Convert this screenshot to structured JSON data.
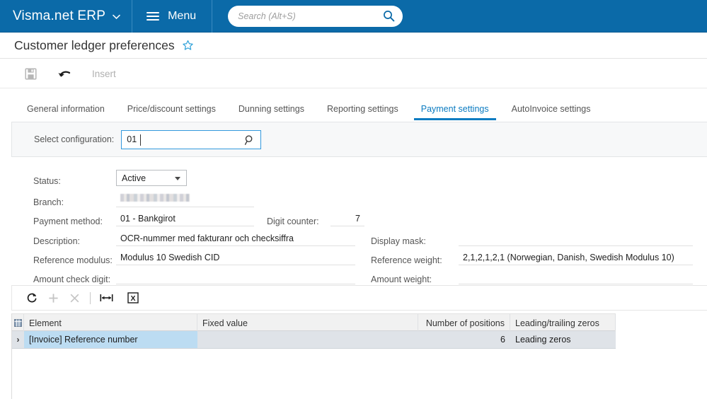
{
  "topbar": {
    "brand": "Visma.net ERP",
    "brand_caret_icon": "chevron-down-icon",
    "menu_label": "Menu",
    "menu_icon": "hamburger-icon",
    "search_placeholder": "Search (Alt+S)",
    "search_value": "",
    "search_icon": "search-icon",
    "background_color": "#0b6aa8"
  },
  "page": {
    "title": "Customer ledger preferences",
    "favorite_icon": "star-icon"
  },
  "action_bar": {
    "save_icon": "save-disk-icon",
    "undo_icon": "undo-arrow-icon",
    "insert_label": "Insert"
  },
  "tabs": [
    {
      "label": "General information",
      "active": false
    },
    {
      "label": "Price/discount settings",
      "active": false
    },
    {
      "label": "Dunning settings",
      "active": false
    },
    {
      "label": "Reporting settings",
      "active": false
    },
    {
      "label": "Payment settings",
      "active": true
    },
    {
      "label": "AutoInvoice settings",
      "active": false
    }
  ],
  "tab_accent_color": "#0b7bc1",
  "config": {
    "label": "Select configuration:",
    "value": "01",
    "placeholder": "",
    "lookup_icon": "magnifier-lookup-icon"
  },
  "form": {
    "status": {
      "label": "Status:",
      "value": "Active",
      "caret_icon": "dropdown-caret-icon"
    },
    "branch": {
      "label": "Branch:",
      "value": "",
      "redacted": true
    },
    "payment_method": {
      "label": "Payment method:",
      "value": "01 - Bankgirot"
    },
    "digit_counter": {
      "label": "Digit counter:",
      "value": "7"
    },
    "description": {
      "label": "Description:",
      "value": "OCR-nummer med fakturanr och checksiffra"
    },
    "display_mask": {
      "label": "Display mask:",
      "value": ""
    },
    "reference_modulus": {
      "label": "Reference modulus:",
      "value": "Modulus 10 Swedish CID"
    },
    "reference_weight": {
      "label": "Reference weight:",
      "value": "2,1,2,1,2,1 (Norwegian, Danish, Swedish Modulus 10)"
    },
    "amount_check_digit": {
      "label": "Amount check digit:",
      "value": ""
    },
    "amount_weight": {
      "label": "Amount weight:",
      "value": ""
    }
  },
  "grid_toolbar": {
    "refresh_icon": "refresh-icon",
    "add_icon": "plus-icon",
    "delete_icon": "close-x-icon",
    "fit_columns_icon": "fit-columns-icon",
    "export_excel_icon": "export-excel-icon"
  },
  "grid": {
    "select_all_icon": "grid-select-all-icon",
    "columns": [
      "Element",
      "Fixed value",
      "Number of positions",
      "Leading/trailing zeros"
    ],
    "rows": [
      {
        "chevron": "›",
        "element": "[Invoice] Reference number",
        "fixed_value": "",
        "number_of_positions": "6",
        "leading_trailing_zeros": "Leading zeros",
        "selected": true
      }
    ],
    "selected_row_color": "#bcdcf2"
  }
}
